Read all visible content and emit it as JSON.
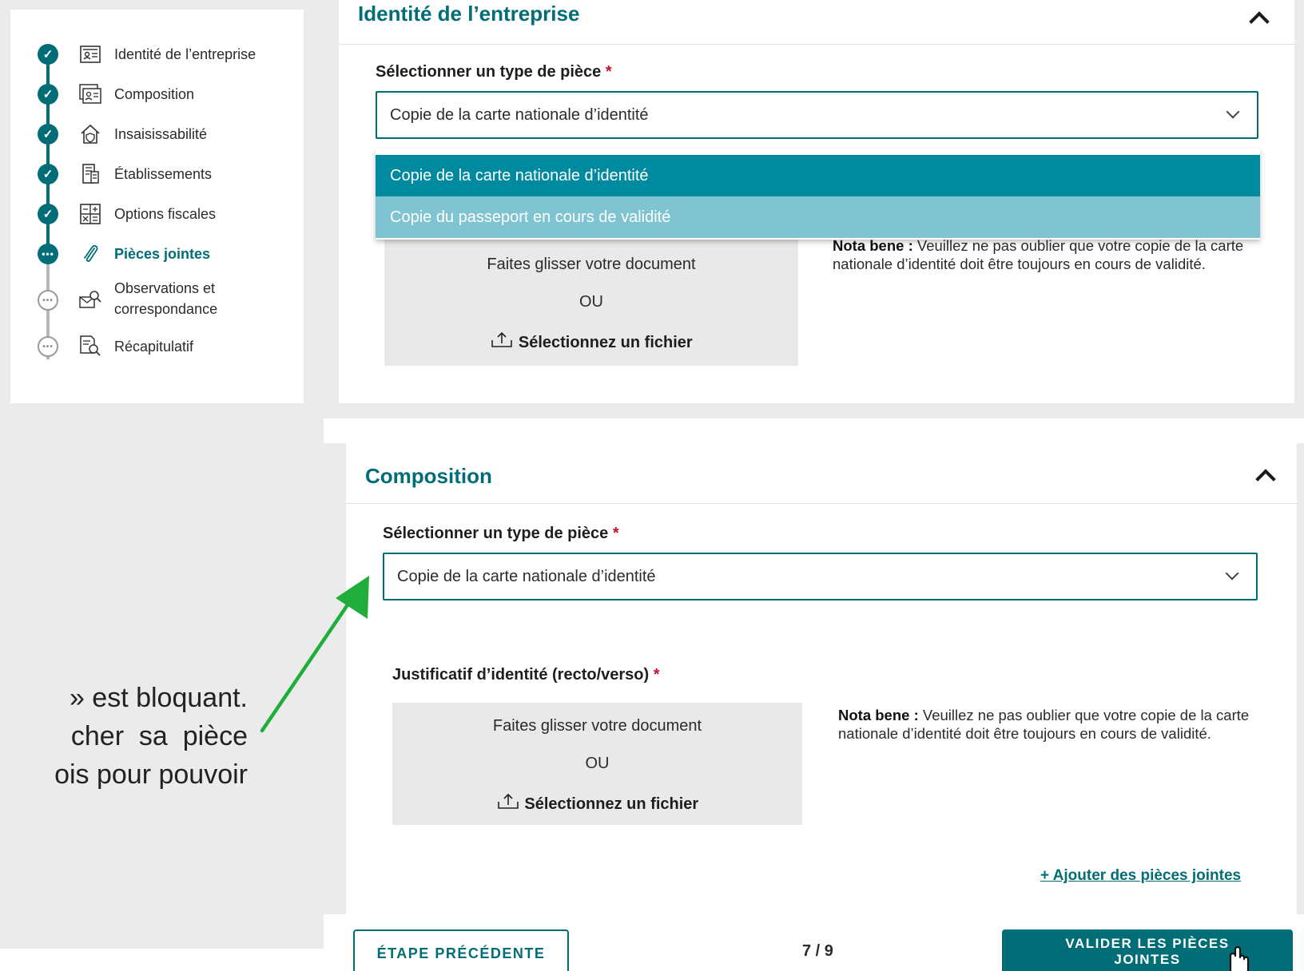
{
  "stepper": {
    "steps": [
      {
        "label": "Identité de l’entreprise",
        "state": "done",
        "icon": "id-card-icon"
      },
      {
        "label": "Composition",
        "state": "done",
        "icon": "org-chart-icon"
      },
      {
        "label": "Insaisissabilité",
        "state": "done",
        "icon": "house-shield-icon"
      },
      {
        "label": "Établissements",
        "state": "done",
        "icon": "building-icon"
      },
      {
        "label": "Options fiscales",
        "state": "done",
        "icon": "tax-grid-icon"
      },
      {
        "label": "Pièces jointes",
        "state": "current",
        "icon": "paperclip-icon"
      },
      {
        "label": "Observations et correspondance",
        "label_line1": "Observations et",
        "label_line2": "correspondance",
        "state": "todo",
        "icon": "mail-search-icon"
      },
      {
        "label": "Récapitulatif",
        "state": "todo",
        "icon": "document-search-icon"
      }
    ]
  },
  "identite_panel": {
    "title": "Identité de l’entreprise",
    "select_label": "Sélectionner un type de pièce",
    "required_mark": "*",
    "select_value": "Copie de la carte nationale d’identité",
    "options": [
      "Copie de la carte nationale d’identité",
      "Copie du passeport en cours de validité"
    ],
    "dropzone": {
      "drag_text": "Faites glisser votre document",
      "or_text": "OU",
      "file_text": "Sélectionnez un fichier"
    },
    "note_label": "Nota bene :",
    "note_text": " Veuillez ne pas oublier que votre copie de la carte nationale d’identité doit être toujours en cours de validité."
  },
  "composition_panel": {
    "title": "Composition",
    "select_label": "Sélectionner un type de pièce",
    "required_mark": "*",
    "select_value": "Copie de la carte nationale d’identité",
    "doc_label": "Justificatif d’identité (recto/verso)",
    "dropzone": {
      "drag_text": "Faites glisser votre document",
      "or_text": "OU",
      "file_text": "Sélectionnez un fichier"
    },
    "note_label": "Nota bene :",
    "note_text": " Veuillez ne pas oublier que votre copie de la carte nationale d’identité doit être toujours en cours de validité.",
    "add_link": "+ Ajouter des pièces jointes"
  },
  "caption": {
    "line1": "» est bloquant.",
    "line2": "cher  sa  pièce",
    "line3": "ois pour pouvoir"
  },
  "footer": {
    "prev_label": "ÉTAPE PRÉCÉDENTE",
    "page_indicator": "7 / 9",
    "next_line1": "VALIDER LES PIÈCES",
    "next_line2": "JOINTES"
  },
  "colors": {
    "accent": "#006d77",
    "option_selected": "#008a9f",
    "option_hover": "#7fc4d0",
    "arrow": "#1fae3c",
    "required": "#c8102e"
  }
}
